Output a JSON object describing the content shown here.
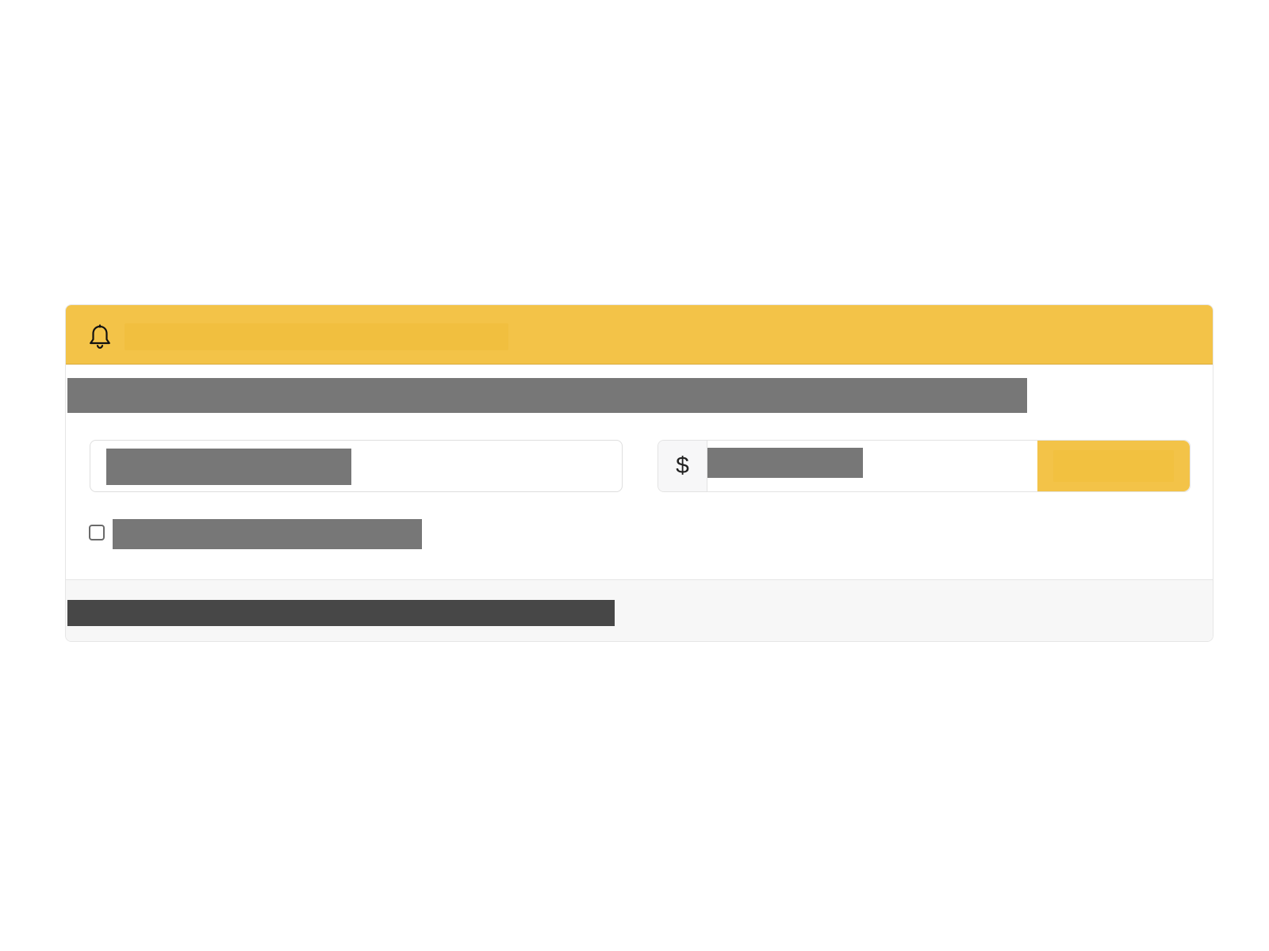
{
  "alert": {
    "icon": "bell-icon",
    "title": "",
    "section_label": "",
    "email_value": "",
    "price_prefix": "$",
    "price_value": "",
    "button_label": "",
    "checkbox_label": "",
    "checkbox_checked": false,
    "footer_text": ""
  },
  "colors": {
    "accent": "#f3c348",
    "masked_text": "#777777",
    "footer_masked_text": "#474747",
    "border": "#e3e3e3",
    "footer_background": "#f7f7f7"
  }
}
